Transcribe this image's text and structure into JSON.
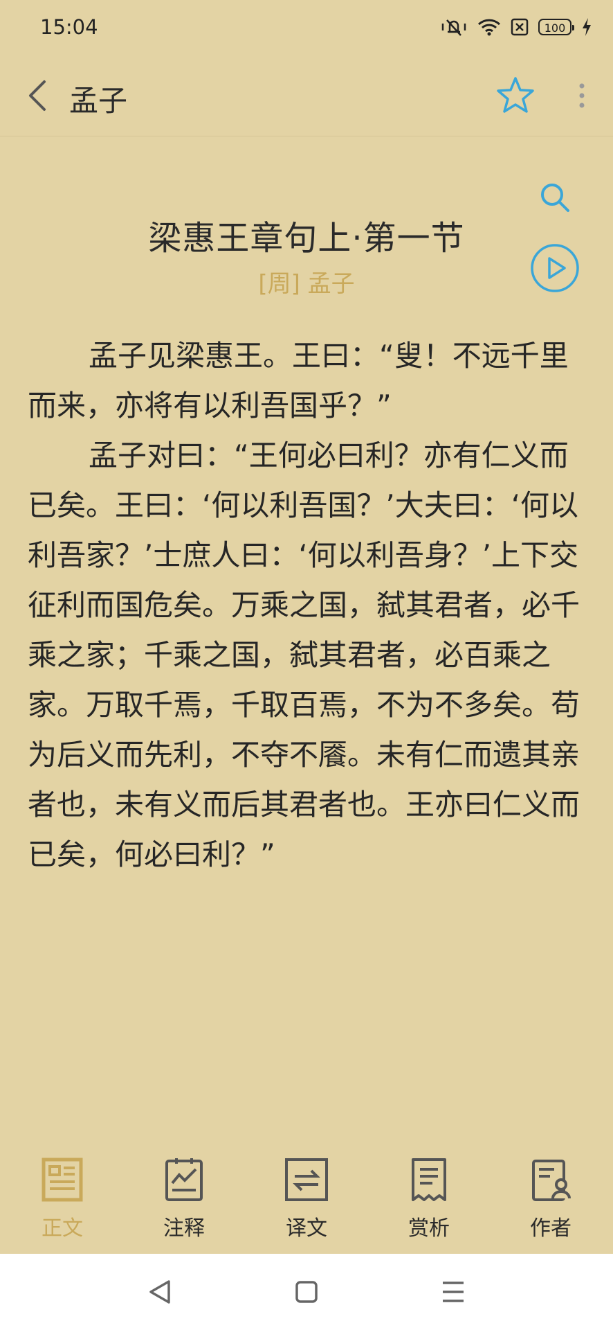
{
  "status": {
    "time": "15:04",
    "battery": "100"
  },
  "header": {
    "title": "孟子",
    "icons": [
      "back-arrow-icon",
      "star-icon",
      "more-vert-icon"
    ]
  },
  "article": {
    "title": "梁惠王章句上·第一节",
    "author": "[周] 孟子",
    "paragraphs": [
      "孟子见梁惠王。王曰：“叟！不远千里而来，亦将有以利吾国乎？”",
      "孟子对曰：“王何必曰利？亦有仁义而已矣。王曰：‘何以利吾国？’大夫曰：‘何以利吾家？’士庶人曰：‘何以利吾身？’上下交征利而国危矣。万乘之国，弑其君者，必千乘之家；千乘之国，弑其君者，必百乘之家。万取千焉，千取百焉，不为不多矣。苟为后义而先利，不夺不餍。未有仁而遗其亲者也，未有义而后其君者也。王亦曰仁义而已矣，何必曰利？”"
    ]
  },
  "tabs": [
    {
      "label": "正文",
      "icon": "text-doc-icon",
      "active": true
    },
    {
      "label": "注释",
      "icon": "notes-chart-icon",
      "active": false
    },
    {
      "label": "译文",
      "icon": "translate-icon",
      "active": false
    },
    {
      "label": "赏析",
      "icon": "receipt-icon",
      "active": false
    },
    {
      "label": "作者",
      "icon": "author-profile-icon",
      "active": false
    }
  ],
  "colors": {
    "background": "#e3d3a4",
    "accent_gold": "#c9a95a",
    "accent_blue": "#3aa6d8"
  }
}
